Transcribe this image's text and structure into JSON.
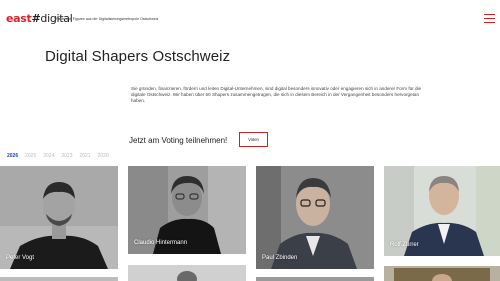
{
  "header": {
    "logo_east": "east",
    "logo_hash": "#",
    "logo_digital": "digital",
    "tagline": "Fakts und Figures aus der Digitalisierungsmetropole Ostschweiz"
  },
  "page_title": "Digital Shapers Ostschweiz",
  "intro": "Sie gründen, finanzieren, fördern und leiten Digital-Unternehmen, sind digital besonders innovativ oder engagieren sich in anderer Form für die digitale Ostschweiz. Wir haben über 50 Shapers zusammengetragen, die sich in diesem Bereich in der Vergangenheit besonders hervorgetan haben.",
  "voting": {
    "text": "Jetzt am Voting teilnehmen!",
    "button_label": "Voten"
  },
  "years": [
    "2026",
    "2025",
    "2024",
    "2023",
    "2021",
    "2020"
  ],
  "active_year": "2026",
  "shapers": [
    {
      "name": "Peter Vogt"
    },
    {
      "name": "Claudio Hintermann"
    },
    {
      "name": "Paul Zbinden"
    },
    {
      "name": "Rolf Zürrer"
    }
  ],
  "colors": {
    "accent": "#c8232a",
    "year_active": "#1a4aa0"
  }
}
